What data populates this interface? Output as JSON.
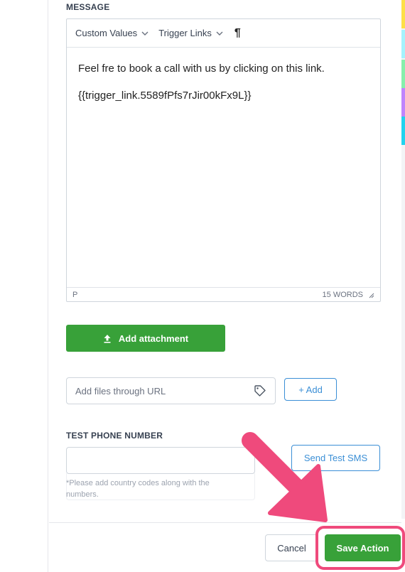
{
  "message": {
    "section_label": "MESSAGE",
    "toolbar": {
      "custom_values": "Custom Values",
      "trigger_links": "Trigger Links",
      "pilcrow": "¶"
    },
    "body_lines": [
      "Feel fre to book a call with us by clicking on this link.",
      "{{trigger_link.5589fPfs7rJir00kFx9L}}"
    ],
    "status": {
      "path": "P",
      "word_count": "15 WORDS"
    }
  },
  "attachment": {
    "button_label": "Add attachment",
    "url_placeholder": "Add files through URL",
    "add_button_label": "+ Add"
  },
  "test_phone": {
    "section_label": "TEST PHONE NUMBER",
    "value": "",
    "hint": "*Please add country codes along with the numbers.",
    "send_button_label": "Send Test SMS"
  },
  "footer": {
    "cancel_label": "Cancel",
    "save_label": "Save Action"
  },
  "colors": {
    "primary_green": "#38a139",
    "link_blue": "#3b8fd6",
    "highlight_pink": "#ef4a7c"
  },
  "icons": {
    "upload": "upload-icon",
    "tag": "tag-icon",
    "chevron": "chevron-down-icon",
    "pointer_arrow": "arrow-annotation"
  }
}
